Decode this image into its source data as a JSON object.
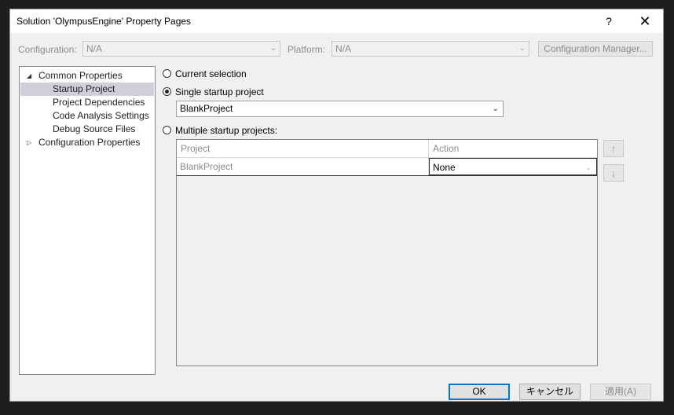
{
  "dialog": {
    "title": "Solution 'OlympusEngine' Property Pages",
    "help_glyph": "?",
    "close_glyph": "✕"
  },
  "config_bar": {
    "configuration_label": "Configuration:",
    "configuration_value": "N/A",
    "platform_label": "Platform:",
    "platform_value": "N/A",
    "config_manager_label": "Configuration Manager..."
  },
  "tree": {
    "items": [
      {
        "label": "Common Properties",
        "expander": "◢"
      },
      {
        "label": "Startup Project"
      },
      {
        "label": "Project Dependencies"
      },
      {
        "label": "Code Analysis Settings"
      },
      {
        "label": "Debug Source Files"
      },
      {
        "label": "Configuration Properties",
        "expander": "▷"
      }
    ]
  },
  "options": {
    "current_selection": "Current selection",
    "single_startup": "Single startup project",
    "single_startup_value": "BlankProject",
    "multiple_startup": "Multiple startup projects:"
  },
  "grid": {
    "columns": [
      "Project",
      "Action"
    ],
    "rows": [
      {
        "project": "BlankProject",
        "action": "None"
      }
    ]
  },
  "side_buttons": {
    "up_glyph": "↑",
    "down_glyph": "↓"
  },
  "footer": {
    "ok_label": "OK",
    "cancel_label": "キャンセル",
    "apply_label": "適用(A)"
  },
  "colors": {
    "dialog_bg": "#f0f0f0",
    "selection": "#cfcfd9",
    "ok_border": "#0078d7"
  }
}
